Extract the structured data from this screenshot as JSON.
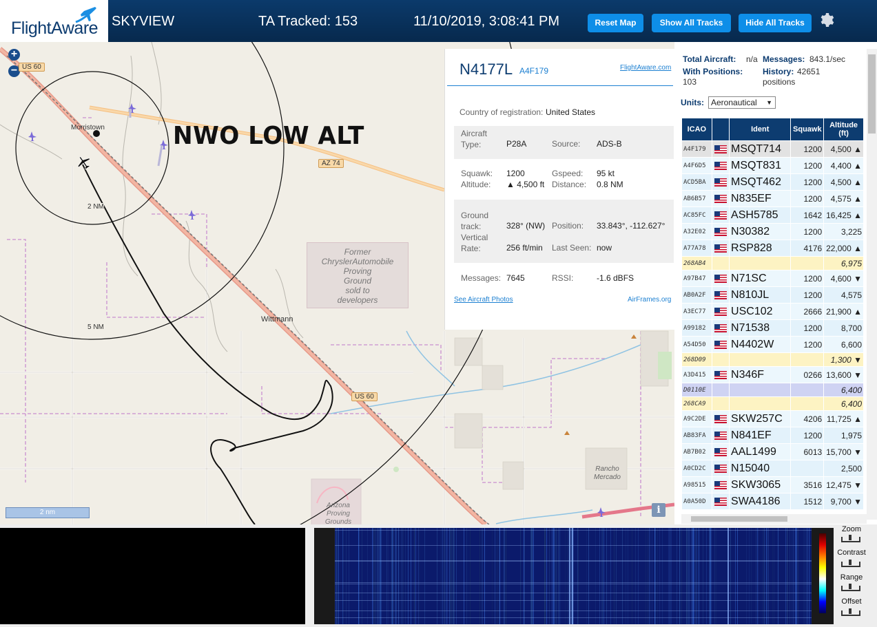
{
  "header": {
    "logo": "FlightAware",
    "app_name": "SKYVIEW",
    "ta_tracked": "TA Tracked: 153",
    "datetime": "11/10/2019, 3:08:41 PM",
    "reset_map_label": "Reset Map",
    "show_all_label": "Show All Tracks",
    "hide_all_label": "Hide All Tracks"
  },
  "map": {
    "overlay_label": "NWO LOW ALT",
    "places": [
      "Morristown",
      "Wittmann"
    ],
    "ring_labels": [
      "2 NM",
      "5 NM"
    ],
    "roads": [
      "US 60",
      "AZ 74",
      "US 60"
    ],
    "former_area": [
      "Former",
      "ChryslerAutomobile",
      "Proving",
      "Ground",
      "sold to",
      "developers"
    ],
    "arizona_area": [
      "Arizona",
      "Proving",
      "Grounds"
    ],
    "rancho": [
      "Rancho",
      "Mercado"
    ],
    "scale_label": "2 nm",
    "zoom_in": "+",
    "zoom_out": "−",
    "info_icon": "i"
  },
  "popup": {
    "registration": "N4177L",
    "icao": "A4F179",
    "fa_link": "FlightAware.com",
    "country_label": "Country of registration:",
    "country_value": "United States",
    "aircraft_type_label": "Aircraft Type:",
    "aircraft_type_value": "P28A",
    "source_label": "Source:",
    "source_value": "ADS-B",
    "squawk_label": "Squawk:",
    "squawk_value": "1200",
    "altitude_label": "Altitude:",
    "altitude_value": "▲ 4,500 ft",
    "gspeed_label": "Gspeed:",
    "gspeed_value": "95 kt",
    "distance_label": "Distance:",
    "distance_value": "0.8 NM",
    "ground_track_label": "Ground track:",
    "ground_track_value": "328° (NW)",
    "position_label": "Position:",
    "position_value": "33.843°, -112.627°",
    "vertical_rate_label": "Vertical Rate:",
    "vertical_rate_value": "256 ft/min",
    "last_seen_label": "Last Seen:",
    "last_seen_value": "now",
    "messages_label": "Messages:",
    "messages_value": "7645",
    "rssi_label": "RSSI:",
    "rssi_value": "-1.6 dBFS",
    "photos_link": "See Aircraft Photos",
    "airframes_link": "AirFrames.org"
  },
  "sidebar": {
    "total_aircraft_label": "Total Aircraft:",
    "total_aircraft_value": "n/a",
    "messages_label": "Messages:",
    "messages_value": "843.1/sec",
    "with_positions_label": "With Positions:",
    "with_positions_value": "103",
    "history_label": "History:",
    "history_value": "42651",
    "history_unit": "positions",
    "units_label": "Units:",
    "units_value": "Aeronautical",
    "columns": [
      "ICAO",
      "",
      "Ident",
      "Squawk",
      "Altitude (ft)"
    ],
    "rows": [
      {
        "icao": "A4F179",
        "flag": true,
        "ident": "MSQT714",
        "squawk": "1200",
        "alt": "4,500 ▲",
        "kind": "sel"
      },
      {
        "icao": "A4F6D5",
        "flag": true,
        "ident": "MSQT831",
        "squawk": "1200",
        "alt": "4,400 ▲",
        "kind": "odd"
      },
      {
        "icao": "ACD5BA",
        "flag": true,
        "ident": "MSQT462",
        "squawk": "1200",
        "alt": "4,500 ▲",
        "kind": "even"
      },
      {
        "icao": "AB6B57",
        "flag": true,
        "ident": "N835EF",
        "squawk": "1200",
        "alt": "4,575 ▲",
        "kind": "odd"
      },
      {
        "icao": "AC85FC",
        "flag": true,
        "ident": "ASH5785",
        "squawk": "1642",
        "alt": "16,425 ▲",
        "kind": "even"
      },
      {
        "icao": "A32E02",
        "flag": true,
        "ident": "N30382",
        "squawk": "1200",
        "alt": "3,225",
        "kind": "odd"
      },
      {
        "icao": "A77A78",
        "flag": true,
        "ident": "RSP828",
        "squawk": "4176",
        "alt": "22,000 ▲",
        "kind": "even"
      },
      {
        "icao": "268AB4",
        "flag": false,
        "ident": "",
        "squawk": "",
        "alt": "6,975",
        "kind": "tisb"
      },
      {
        "icao": "A97B47",
        "flag": true,
        "ident": "N71SC",
        "squawk": "1200",
        "alt": "4,600 ▼",
        "kind": "odd"
      },
      {
        "icao": "AB0A2F",
        "flag": true,
        "ident": "N810JL",
        "squawk": "1200",
        "alt": "4,575",
        "kind": "even"
      },
      {
        "icao": "A3EC77",
        "flag": true,
        "ident": "USC102",
        "squawk": "2666",
        "alt": "21,900 ▲",
        "kind": "odd"
      },
      {
        "icao": "A99182",
        "flag": true,
        "ident": "N71538",
        "squawk": "1200",
        "alt": "8,700",
        "kind": "even"
      },
      {
        "icao": "A54D50",
        "flag": true,
        "ident": "N4402W",
        "squawk": "1200",
        "alt": "6,600",
        "kind": "odd"
      },
      {
        "icao": "268D09",
        "flag": false,
        "ident": "",
        "squawk": "",
        "alt": "1,300 ▼",
        "kind": "tisb"
      },
      {
        "icao": "A3D415",
        "flag": true,
        "ident": "N346F",
        "squawk": "0266",
        "alt": "13,600 ▼",
        "kind": "odd"
      },
      {
        "icao": "D0110E",
        "flag": false,
        "ident": "",
        "squawk": "",
        "alt": "6,400",
        "kind": "mlat"
      },
      {
        "icao": "268CA9",
        "flag": false,
        "ident": "",
        "squawk": "",
        "alt": "6,400",
        "kind": "tisb"
      },
      {
        "icao": "A9C2DE",
        "flag": true,
        "ident": "SKW257C",
        "squawk": "4206",
        "alt": "11,725 ▲",
        "kind": "odd"
      },
      {
        "icao": "AB83FA",
        "flag": true,
        "ident": "N841EF",
        "squawk": "1200",
        "alt": "1,975",
        "kind": "even"
      },
      {
        "icao": "AB7B02",
        "flag": true,
        "ident": "AAL1499",
        "squawk": "6013",
        "alt": "15,700 ▼",
        "kind": "odd"
      },
      {
        "icao": "A0CD2C",
        "flag": true,
        "ident": "N15040",
        "squawk": "",
        "alt": "2,500",
        "kind": "even"
      },
      {
        "icao": "A98515",
        "flag": true,
        "ident": "SKW3065",
        "squawk": "3516",
        "alt": "12,475 ▼",
        "kind": "odd"
      },
      {
        "icao": "A0A50D",
        "flag": true,
        "ident": "SWA4186",
        "squawk": "1512",
        "alt": "9,700 ▼",
        "kind": "even"
      }
    ]
  },
  "bottom": {
    "zoom_label": "Zoom",
    "contrast_label": "Contrast",
    "range_label": "Range",
    "offset_label": "Offset"
  },
  "colors": {
    "header_bg": "#0b3a6b",
    "button": "#0e8ee8",
    "brand": "#0d3c70"
  },
  "icons": [
    "plane-logo-icon",
    "gear-icon",
    "zoom-in-icon",
    "zoom-out-icon",
    "info-icon",
    "us-flag-icon"
  ]
}
